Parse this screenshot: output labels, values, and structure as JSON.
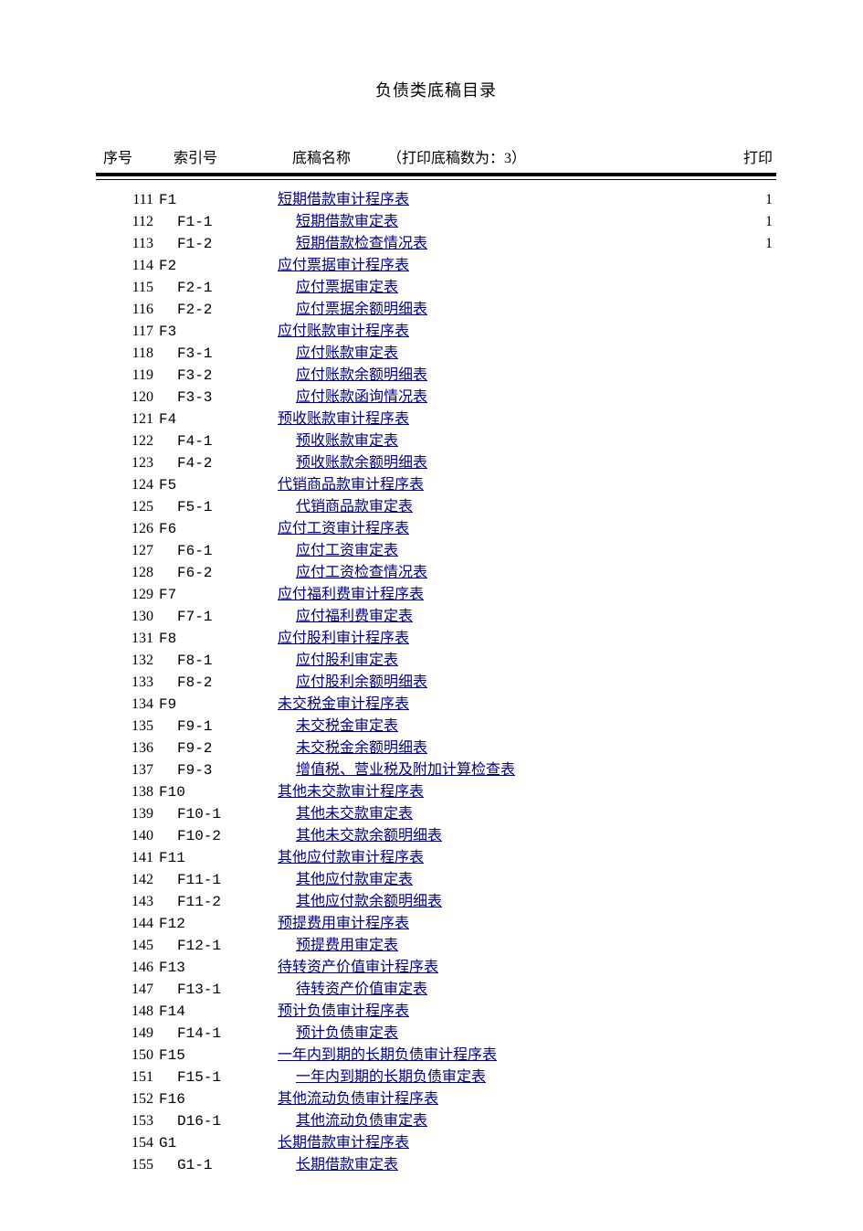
{
  "title": "负债类底稿目录",
  "header": {
    "seq": "序号",
    "index": "索引号",
    "name": "底稿名称",
    "note": "（打印底稿数为：3）",
    "print": "打印"
  },
  "rows": [
    {
      "seq": "111",
      "index": "F1",
      "sub": false,
      "name": "短期借款审计程序表",
      "print": "1"
    },
    {
      "seq": "112",
      "index": "F1-1",
      "sub": true,
      "name": "短期借款审定表",
      "print": "1"
    },
    {
      "seq": "113",
      "index": "F1-2",
      "sub": true,
      "name": "短期借款检查情况表",
      "print": "1"
    },
    {
      "seq": "114",
      "index": "F2",
      "sub": false,
      "name": "应付票据审计程序表",
      "print": ""
    },
    {
      "seq": "115",
      "index": "F2-1",
      "sub": true,
      "name": "应付票据审定表",
      "print": ""
    },
    {
      "seq": "116",
      "index": "F2-2",
      "sub": true,
      "name": "应付票据余额明细表",
      "print": ""
    },
    {
      "seq": "117",
      "index": "F3",
      "sub": false,
      "name": "应付账款审计程序表",
      "print": ""
    },
    {
      "seq": "118",
      "index": "F3-1",
      "sub": true,
      "name": "应付账款审定表",
      "print": ""
    },
    {
      "seq": "119",
      "index": "F3-2",
      "sub": true,
      "name": "应付账款余额明细表",
      "print": ""
    },
    {
      "seq": "120",
      "index": "F3-3",
      "sub": true,
      "name": "应付账款函询情况表",
      "print": ""
    },
    {
      "seq": "121",
      "index": "F4",
      "sub": false,
      "name": "预收账款审计程序表",
      "print": ""
    },
    {
      "seq": "122",
      "index": "F4-1",
      "sub": true,
      "name": "预收账款审定表",
      "print": ""
    },
    {
      "seq": "123",
      "index": "F4-2",
      "sub": true,
      "name": "预收账款余额明细表",
      "print": ""
    },
    {
      "seq": "124",
      "index": "F5",
      "sub": false,
      "name": "代销商品款审计程序表",
      "print": ""
    },
    {
      "seq": "125",
      "index": "F5-1",
      "sub": true,
      "name": "代销商品款审定表",
      "print": ""
    },
    {
      "seq": "126",
      "index": "F6",
      "sub": false,
      "name": "应付工资审计程序表",
      "print": ""
    },
    {
      "seq": "127",
      "index": "F6-1",
      "sub": true,
      "name": "应付工资审定表",
      "print": ""
    },
    {
      "seq": "128",
      "index": "F6-2",
      "sub": true,
      "name": "应付工资检查情况表",
      "print": ""
    },
    {
      "seq": "129",
      "index": "F7",
      "sub": false,
      "name": "应付福利费审计程序表",
      "print": ""
    },
    {
      "seq": "130",
      "index": "F7-1",
      "sub": true,
      "name": "应付福利费审定表",
      "print": ""
    },
    {
      "seq": "131",
      "index": "F8",
      "sub": false,
      "name": "应付股利审计程序表",
      "print": ""
    },
    {
      "seq": "132",
      "index": "F8-1",
      "sub": true,
      "name": "应付股利审定表",
      "print": ""
    },
    {
      "seq": "133",
      "index": "F8-2",
      "sub": true,
      "name": "应付股利余额明细表",
      "print": ""
    },
    {
      "seq": "134",
      "index": "F9",
      "sub": false,
      "name": "未交税金审计程序表",
      "print": ""
    },
    {
      "seq": "135",
      "index": "F9-1",
      "sub": true,
      "name": "未交税金审定表",
      "print": ""
    },
    {
      "seq": "136",
      "index": "F9-2",
      "sub": true,
      "name": "未交税金余额明细表",
      "print": ""
    },
    {
      "seq": "137",
      "index": "F9-3",
      "sub": true,
      "name": "增值税、营业税及附加计算检查表",
      "print": ""
    },
    {
      "seq": "138",
      "index": "F10",
      "sub": false,
      "name": "其他未交款审计程序表",
      "print": ""
    },
    {
      "seq": "139",
      "index": "F10-1",
      "sub": true,
      "name": "其他未交款审定表",
      "print": ""
    },
    {
      "seq": "140",
      "index": "F10-2",
      "sub": true,
      "name": "其他未交款余额明细表",
      "print": ""
    },
    {
      "seq": "141",
      "index": "F11",
      "sub": false,
      "name": "其他应付款审计程序表",
      "print": ""
    },
    {
      "seq": "142",
      "index": "F11-1",
      "sub": true,
      "name": "其他应付款审定表",
      "print": ""
    },
    {
      "seq": "143",
      "index": "F11-2",
      "sub": true,
      "name": "其他应付款余额明细表",
      "print": ""
    },
    {
      "seq": "144",
      "index": "F12",
      "sub": false,
      "name": "预提费用审计程序表",
      "print": ""
    },
    {
      "seq": "145",
      "index": "F12-1",
      "sub": true,
      "name": "预提费用审定表",
      "print": ""
    },
    {
      "seq": "146",
      "index": "F13",
      "sub": false,
      "name": "待转资产价值审计程序表",
      "print": ""
    },
    {
      "seq": "147",
      "index": "F13-1",
      "sub": true,
      "name": "待转资产价值审定表",
      "print": ""
    },
    {
      "seq": "148",
      "index": "F14",
      "sub": false,
      "name": "预计负债审计程序表",
      "print": ""
    },
    {
      "seq": "149",
      "index": "F14-1",
      "sub": true,
      "name": "预计负债审定表",
      "print": ""
    },
    {
      "seq": "150",
      "index": "F15",
      "sub": false,
      "name": "一年内到期的长期负债审计程序表",
      "print": ""
    },
    {
      "seq": "151",
      "index": "F15-1",
      "sub": true,
      "name": "一年内到期的长期负债审定表",
      "print": ""
    },
    {
      "seq": "152",
      "index": "F16",
      "sub": false,
      "name": "其他流动负债审计程序表",
      "print": ""
    },
    {
      "seq": "153",
      "index": "D16-1",
      "sub": true,
      "name": "其他流动负债审定表",
      "print": ""
    },
    {
      "seq": "154",
      "index": "G1",
      "sub": false,
      "name": "长期借款审计程序表",
      "print": ""
    },
    {
      "seq": "155",
      "index": "G1-1",
      "sub": true,
      "name": "长期借款审定表",
      "print": ""
    }
  ]
}
